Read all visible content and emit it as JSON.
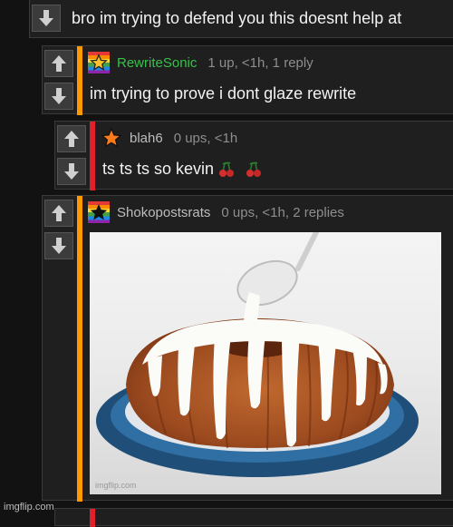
{
  "comments": [
    {
      "text": "bro im trying to defend you this doesnt help at"
    },
    {
      "username": "RewriteSonic",
      "stats": "1 up, <1h, 1 reply",
      "text": "im trying to prove i dont glaze rewrite",
      "username_color": "#35c24a",
      "bar_color": "#ff9900",
      "badge_icon": "rainbow-star-badge"
    },
    {
      "username": "blah6",
      "stats": "0 ups, <1h",
      "text": "ts ts ts so kevin",
      "username_color": "#bdbdbd",
      "bar_color": "#e0202a",
      "badge_icon": "orange-star-badge"
    },
    {
      "username": "Shokopostsrats",
      "stats": "0 ups, <1h, 2 replies",
      "username_color": "#bdbdbd",
      "bar_color": "#ff9900",
      "badge_icon": "black-star-rainbow-badge",
      "image_watermark": "imgflip.com"
    }
  ],
  "site_watermark": "imgflip.com"
}
